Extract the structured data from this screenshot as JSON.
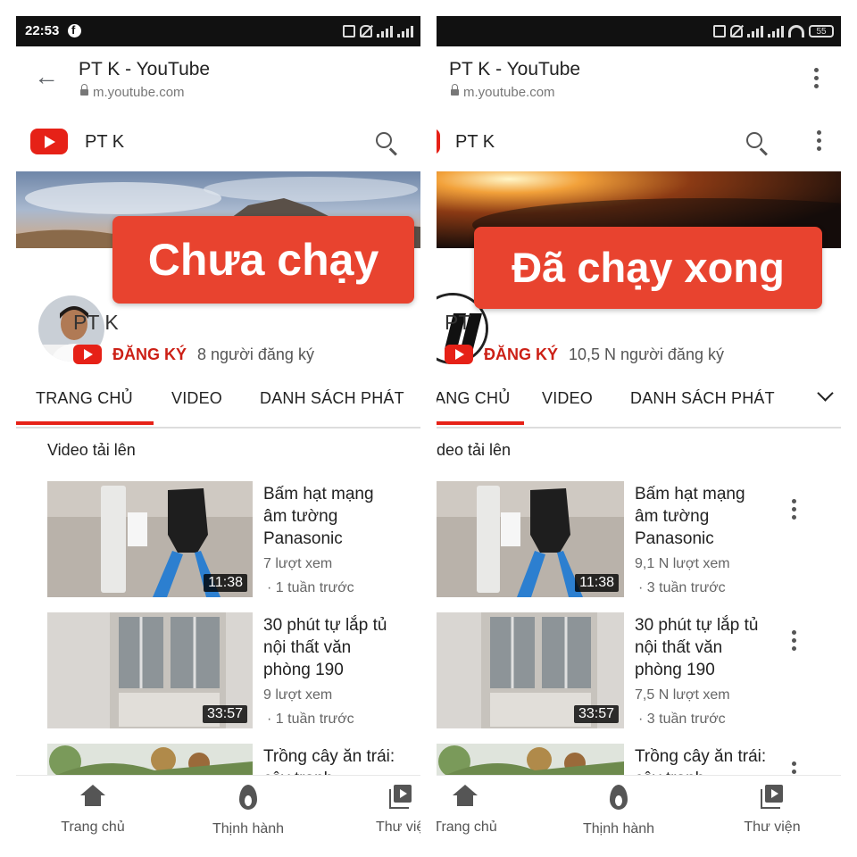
{
  "left": {
    "status": {
      "time": "22:53"
    },
    "browser": {
      "title": "PT K - YouTube",
      "url": "m.youtube.com"
    },
    "yt": {
      "channel": "PT K"
    },
    "sticker": "Chưa chạy",
    "channel": {
      "name": "PT K",
      "subscribe_label": "ĐĂNG KÝ",
      "subscribers": "8 người đăng ký"
    },
    "tabs": [
      "TRANG CHỦ",
      "VIDEO",
      "DANH SÁCH PHÁT"
    ],
    "section_title": "Video tải lên",
    "videos": [
      {
        "title": "Bấm hạt mạng âm tường Panasonic",
        "duration": "11:38",
        "views": "7 lượt xem",
        "age": "· 1 tuần trước"
      },
      {
        "title": "30 phút tự lắp tủ nội thất văn phòng 190",
        "duration": "33:57",
        "views": "9 lượt xem",
        "age": "· 1 tuần trước"
      },
      {
        "title": "Trồng cây ăn trái: cây tranh"
      }
    ],
    "nav": [
      "Trang chủ",
      "Thịnh hành",
      "Thư việ"
    ]
  },
  "right": {
    "status": {
      "battery": "55"
    },
    "browser": {
      "title": "PT K - YouTube",
      "url": "m.youtube.com"
    },
    "yt": {
      "channel": "PT K"
    },
    "sticker": "Đã chạy xong",
    "channel": {
      "name": "PT",
      "subscribe_label": "ĐĂNG KÝ",
      "subscribers": "10,5 N người đăng ký"
    },
    "tabs": [
      "ANG CHỦ",
      "VIDEO",
      "DANH SÁCH PHÁT"
    ],
    "section_title": "deo tải lên",
    "videos": [
      {
        "title": "Bấm hạt mạng âm tường Panasonic",
        "duration": "11:38",
        "views": "9,1 N lượt xem",
        "age": "· 3 tuần trước"
      },
      {
        "title": "30 phút tự lắp tủ nội thất văn phòng 190",
        "duration": "33:57",
        "views": "7,5 N lượt xem",
        "age": "· 3 tuần trước"
      },
      {
        "title": "Trồng cây ăn trái: cây tranh"
      }
    ],
    "nav": [
      "Trang chủ",
      "Thịnh hành",
      "Thư viện"
    ]
  },
  "icons": [
    "back-arrow-icon",
    "lock-icon",
    "youtube-logo-icon",
    "search-icon",
    "more-vert-icon",
    "chevron-down-icon",
    "home-icon",
    "trending-fire-icon",
    "library-icon",
    "facebook-icon",
    "wifi-icon",
    "battery-icon"
  ],
  "colors": {
    "youtube_red": "#e62117",
    "sticker_red": "#e8432f",
    "subscribe_red": "#cc2016"
  }
}
